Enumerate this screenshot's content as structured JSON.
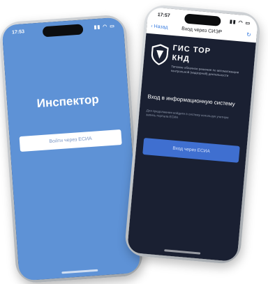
{
  "phone_left": {
    "status_time": "17:53",
    "status_icons": "▮▮ ◠ ▭",
    "title": "Инспектор",
    "login_button": "Войти через ЕСИА"
  },
  "phone_right": {
    "status_time": "17:57",
    "status_icons": "▮▮ ◠ ▭",
    "back": "‹ Назад",
    "nav_title": "Вход через СИЭР",
    "brand_line1": "ГИС ТОР",
    "brand_line2": "КНД",
    "brand_description": "Типовое облачное решение по автоматизации контрольной (надзорной) деятельности",
    "heading": "Вход в информационную систему",
    "subtext": "Для продолжения войдите в систему используя учетную запись портала ЕСИА",
    "login_button": "Вход через ЕСИА"
  }
}
